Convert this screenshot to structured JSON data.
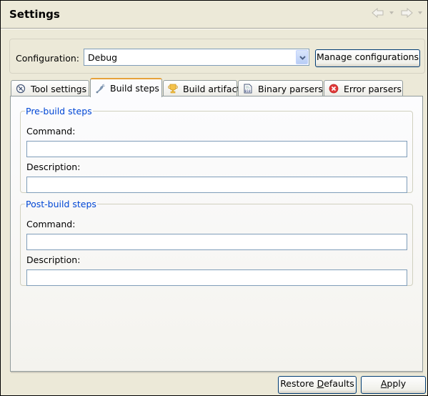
{
  "header": {
    "title": "Settings",
    "back_icon": "back-arrow-icon",
    "forward_icon": "forward-arrow-icon"
  },
  "configuration": {
    "label": "Configuration:",
    "selected": "Debug",
    "manage_button": "Manage configurations"
  },
  "tabs": [
    {
      "label": "Tool settings",
      "icon": "tool-settings-icon",
      "active": false
    },
    {
      "label": "Build steps",
      "icon": "build-steps-icon",
      "active": true
    },
    {
      "label": "Build artifact",
      "icon": "trophy-icon",
      "active": false
    },
    {
      "label": "Binary parsers",
      "icon": "binary-file-icon",
      "active": false
    },
    {
      "label": "Error parsers",
      "icon": "error-icon",
      "active": false
    }
  ],
  "pre_build": {
    "legend": "Pre-build steps",
    "command_label": "Command:",
    "command_value": "",
    "description_label": "Description:",
    "description_value": ""
  },
  "post_build": {
    "legend": "Post-build steps",
    "command_label": "Command:",
    "command_value": "",
    "description_label": "Description:",
    "description_value": ""
  },
  "footer": {
    "restore_pre": "Restore ",
    "restore_mnemonic": "D",
    "restore_post": "efaults",
    "apply_mnemonic": "A",
    "apply_post": "pply"
  },
  "colors": {
    "accent_tab": "#e6a23a",
    "legend": "#0046d5",
    "window_bg": "#ece9d8"
  }
}
